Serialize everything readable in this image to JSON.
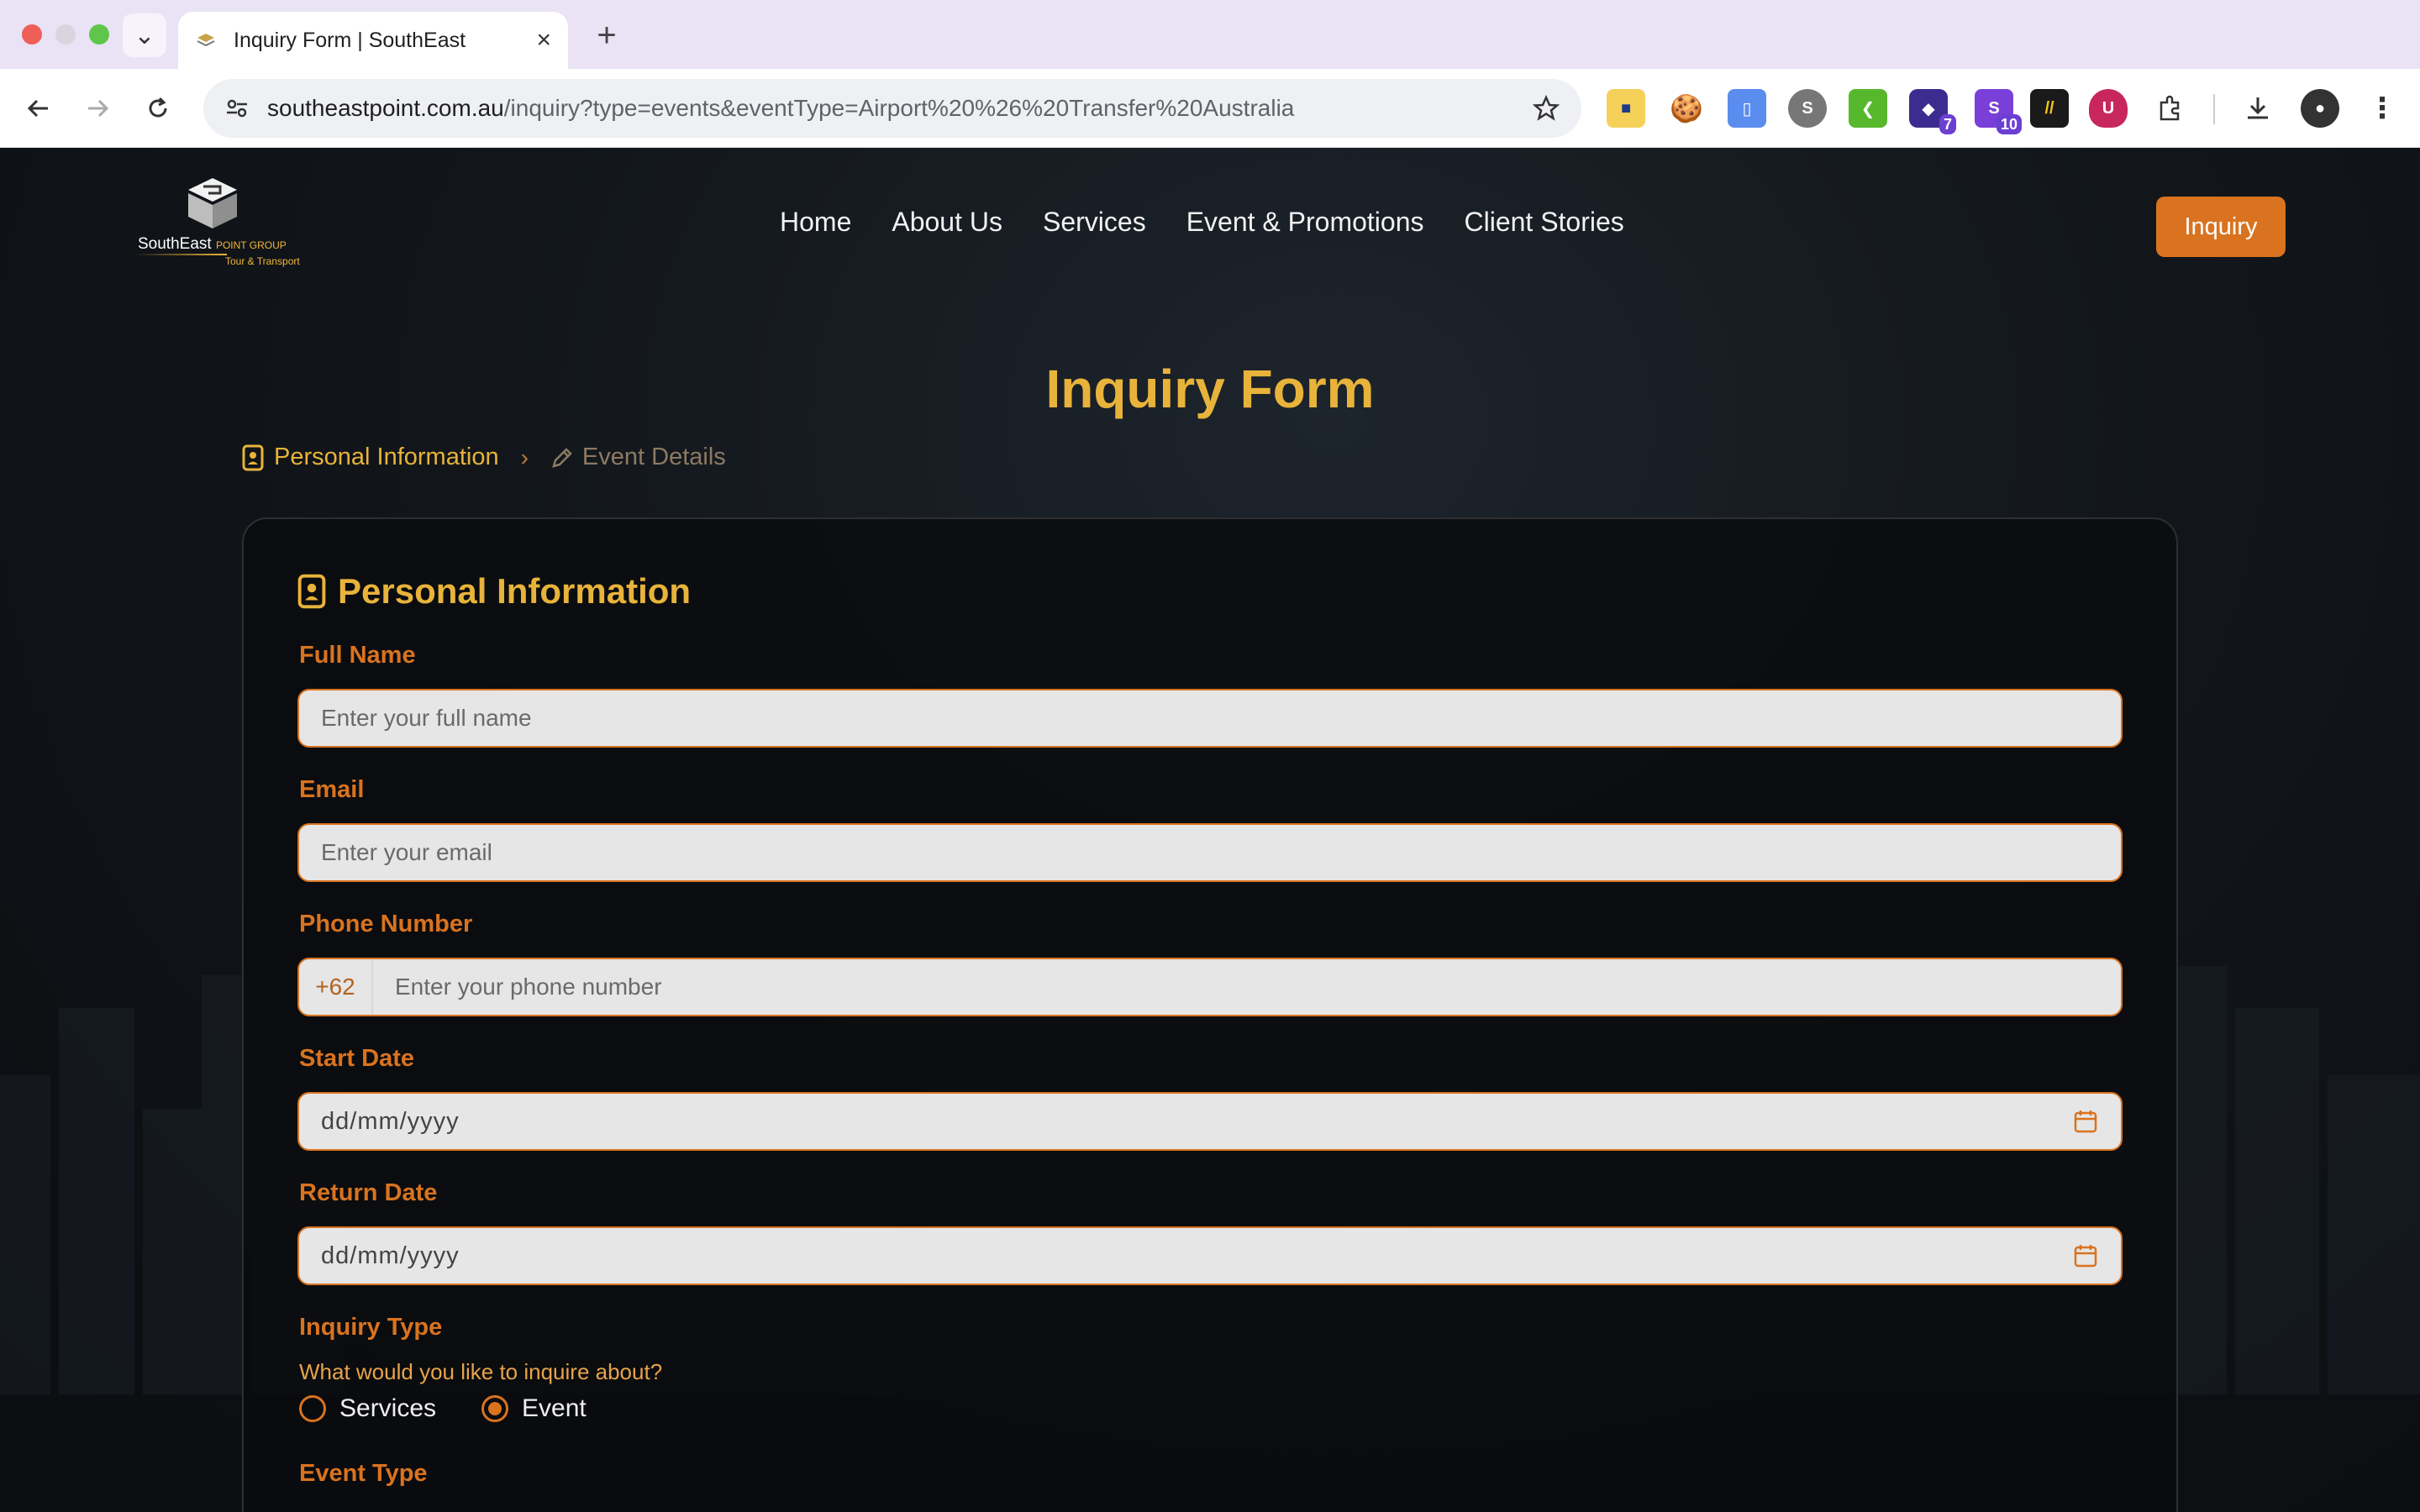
{
  "browser": {
    "tab_title": "Inquiry Form | SouthEast",
    "url_host": "southeastpoint.com.au",
    "url_path": "/inquiry?type=events&eventType=Airport%20%26%20Transfer%20Australia",
    "extension_badges": [
      "7",
      "10"
    ]
  },
  "site": {
    "logo": {
      "name": "SouthEast",
      "accent": "POINT GROUP",
      "tagline": "Tour & Transport"
    },
    "nav": [
      "Home",
      "About Us",
      "Services",
      "Event & Promotions",
      "Client Stories"
    ],
    "cta_label": "Inquiry"
  },
  "form": {
    "title": "Inquiry Form",
    "steps": {
      "active": "Personal Information",
      "next": "Event Details"
    },
    "section_title": "Personal Information",
    "full_name": {
      "label": "Full Name",
      "placeholder": "Enter your full name"
    },
    "email": {
      "label": "Email",
      "placeholder": "Enter your email"
    },
    "phone": {
      "label": "Phone Number",
      "prefix": "+62",
      "placeholder": "Enter your phone number"
    },
    "start_date": {
      "label": "Start Date",
      "placeholder": "dd/mm/yyyy"
    },
    "return_date": {
      "label": "Return Date",
      "placeholder": "dd/mm/yyyy"
    },
    "inquiry_type": {
      "label": "Inquiry Type",
      "hint": "What would you like to inquire about?",
      "options": [
        "Services",
        "Event"
      ],
      "selected": "Event"
    },
    "event_type": {
      "label": "Event Type"
    }
  },
  "colors": {
    "accent": "#d9731f",
    "gold": "#e8b33a",
    "input_bg": "#e6e6e6"
  }
}
